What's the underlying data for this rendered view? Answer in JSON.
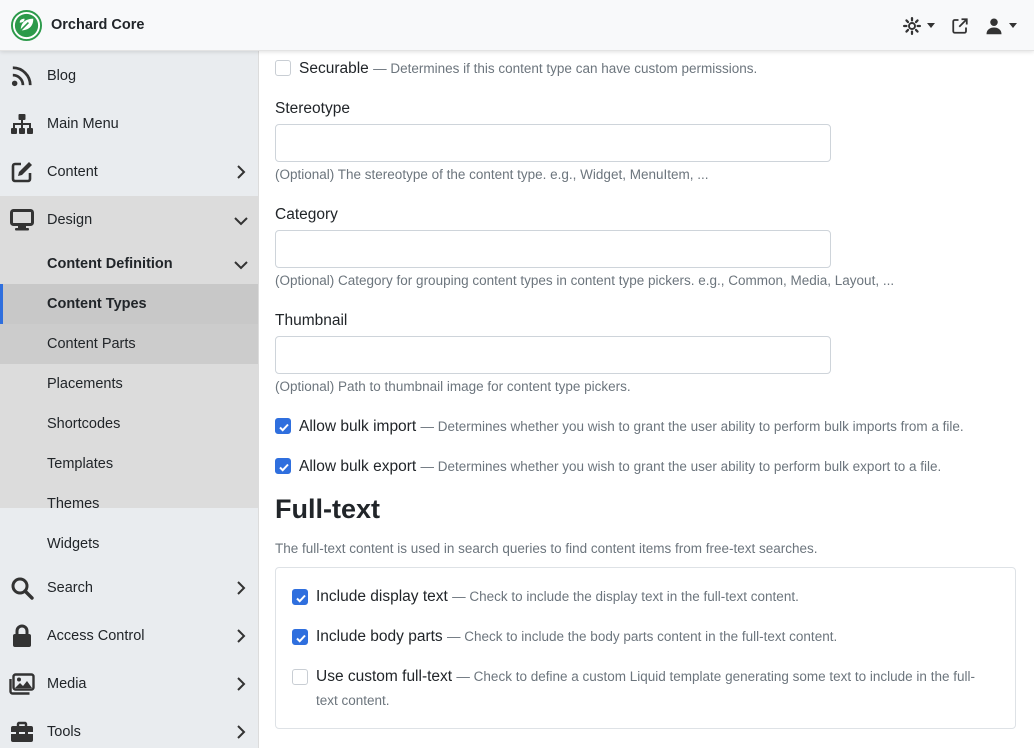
{
  "app": {
    "title": "Orchard Core",
    "brand_color": "#2c9a4a"
  },
  "navbar": {
    "icons": [
      "gear-icon",
      "external-link-icon",
      "user-icon"
    ]
  },
  "sidebar": {
    "items": [
      {
        "label": "Blog",
        "icon": "rss-icon"
      },
      {
        "label": "Main Menu",
        "icon": "sitemap-icon"
      },
      {
        "label": "Content",
        "icon": "edit-icon"
      },
      {
        "label": "Design",
        "icon": "desktop-icon"
      },
      {
        "label": "Search",
        "icon": "search-icon"
      },
      {
        "label": "Access Control",
        "icon": "lock-icon"
      },
      {
        "label": "Media",
        "icon": "images-icon"
      },
      {
        "label": "Tools",
        "icon": "toolbox-icon"
      }
    ],
    "design_sub": {
      "group_label": "Content Definition",
      "items": [
        "Content Types",
        "Content Parts"
      ],
      "other_items": [
        "Placements",
        "Shortcodes",
        "Templates",
        "Themes",
        "Widgets"
      ]
    }
  },
  "form": {
    "securable": {
      "label": "Securable",
      "hint": "— Determines if this content type can have custom permissions.",
      "checked": false
    },
    "stereotype": {
      "label": "Stereotype",
      "value": "",
      "help": "(Optional) The stereotype of the content type. e.g., Widget, MenuItem, ..."
    },
    "category": {
      "label": "Category",
      "value": "",
      "help": "(Optional) Category for grouping content types in content type pickers. e.g., Common, Media, Layout, ..."
    },
    "thumbnail": {
      "label": "Thumbnail",
      "value": "",
      "help": "(Optional) Path to thumbnail image for content type pickers."
    },
    "bulk_import": {
      "label": "Allow bulk import",
      "hint": "— Determines whether you wish to grant the user ability to perform bulk imports from a file.",
      "checked": true
    },
    "bulk_export": {
      "label": "Allow bulk export",
      "hint": "— Determines whether you wish to grant the user ability to perform bulk export to a file.",
      "checked": true
    }
  },
  "fulltext": {
    "title": "Full-text",
    "description": "The full-text content is used in search queries to find content items from free-text searches.",
    "options": [
      {
        "label": "Include display text",
        "hint": "— Check to include the display text in the full-text content.",
        "checked": true
      },
      {
        "label": "Include body parts",
        "hint": "— Check to include the body parts content in the full-text content.",
        "checked": true
      },
      {
        "label": "Use custom full-text",
        "hint": "— Check to define a custom Liquid template generating some text to include in the full-",
        "hint2": "text content.",
        "checked": false
      }
    ]
  }
}
